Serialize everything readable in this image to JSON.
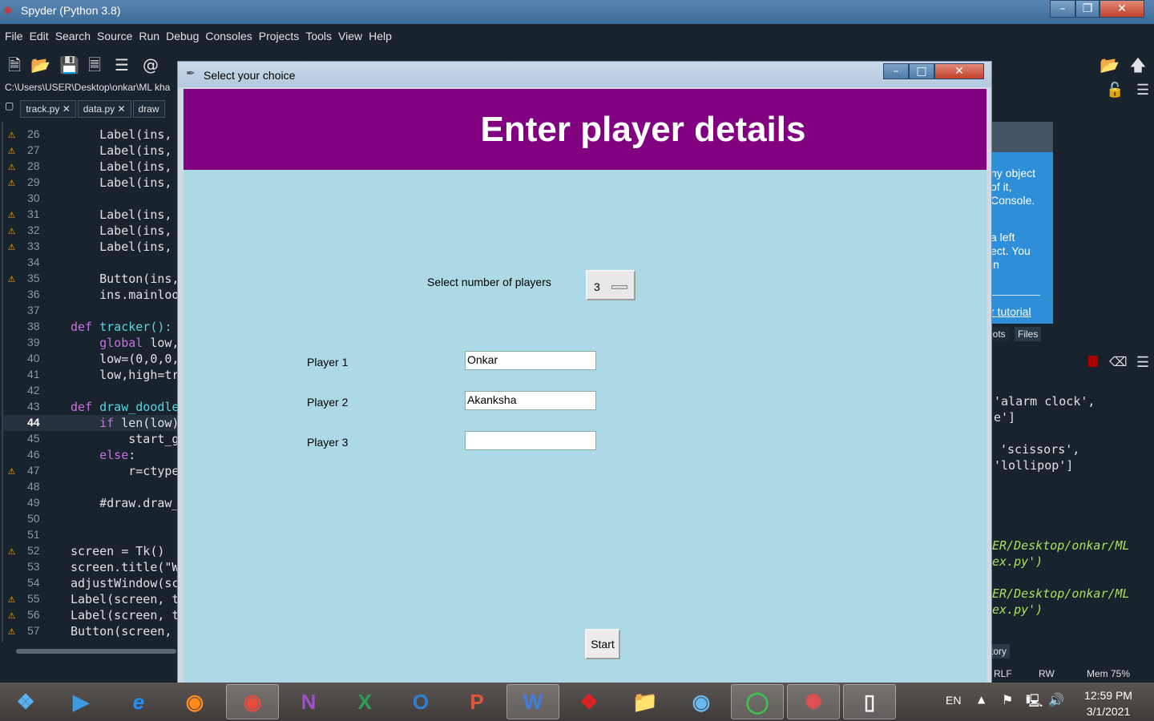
{
  "app": {
    "title": "Spyder (Python 3.8)",
    "menu": [
      "File",
      "Edit",
      "Search",
      "Source",
      "Run",
      "Debug",
      "Consoles",
      "Projects",
      "Tools",
      "View",
      "Help"
    ],
    "path": "C:\\Users\\USER\\Desktop\\onkar\\ML kha",
    "tabs": [
      "track.py",
      "data.py",
      "draw"
    ]
  },
  "editor": {
    "lines": [
      {
        "n": "26",
        "warn": true,
        "code": "    Label(ins,"
      },
      {
        "n": "27",
        "warn": true,
        "code": "    Label(ins,"
      },
      {
        "n": "28",
        "warn": true,
        "code": "    Label(ins,"
      },
      {
        "n": "29",
        "warn": true,
        "code": "    Label(ins,"
      },
      {
        "n": "30",
        "warn": false,
        "code": ""
      },
      {
        "n": "31",
        "warn": true,
        "code": "    Label(ins,"
      },
      {
        "n": "32",
        "warn": true,
        "code": "    Label(ins,"
      },
      {
        "n": "33",
        "warn": true,
        "code": "    Label(ins,"
      },
      {
        "n": "34",
        "warn": false,
        "code": ""
      },
      {
        "n": "35",
        "warn": true,
        "code": "    Button(ins,"
      },
      {
        "n": "36",
        "warn": false,
        "code": "    ins.mainloo"
      },
      {
        "n": "37",
        "warn": false,
        "code": ""
      },
      {
        "n": "38",
        "warn": false,
        "code": "def tracker():"
      },
      {
        "n": "39",
        "warn": false,
        "code": "    global low,"
      },
      {
        "n": "40",
        "warn": false,
        "code": "    low=(0,0,0,"
      },
      {
        "n": "41",
        "warn": false,
        "code": "    low,high=tr"
      },
      {
        "n": "42",
        "warn": false,
        "code": ""
      },
      {
        "n": "43",
        "warn": false,
        "code": "def draw_doodle"
      },
      {
        "n": "44",
        "warn": false,
        "code": "    if len(low)",
        "cur": true
      },
      {
        "n": "45",
        "warn": false,
        "code": "        start_g"
      },
      {
        "n": "46",
        "warn": false,
        "code": "    else:"
      },
      {
        "n": "47",
        "warn": true,
        "code": "        r=ctype"
      },
      {
        "n": "48",
        "warn": false,
        "code": ""
      },
      {
        "n": "49",
        "warn": false,
        "code": "    #draw.draw_"
      },
      {
        "n": "50",
        "warn": false,
        "code": ""
      },
      {
        "n": "51",
        "warn": false,
        "code": ""
      },
      {
        "n": "52",
        "warn": true,
        "code": "screen = Tk()"
      },
      {
        "n": "53",
        "warn": false,
        "code": "screen.title(\"W"
      },
      {
        "n": "54",
        "warn": false,
        "code": "adjustWindow(sc"
      },
      {
        "n": "55",
        "warn": true,
        "code": "Label(screen, t"
      },
      {
        "n": "56",
        "warn": true,
        "code": "Label(screen, t"
      },
      {
        "n": "57",
        "warn": true,
        "code": "Button(screen, "
      }
    ]
  },
  "help": {
    "lines": [
      "ny object",
      "of it,",
      "Console.",
      "",
      "a left",
      "ect. You",
      "in"
    ],
    "link": "r tutorial",
    "tabs": [
      "lots",
      "Files"
    ]
  },
  "console": {
    "lines": [
      "'alarm clock',",
      "e']",
      "",
      "'scissors',",
      "'lollipop']"
    ],
    "paths": [
      "ER/Desktop/onkar/ML",
      "ex.py')",
      "",
      "ER/Desktop/onkar/ML",
      "ex.py')"
    ],
    "history_tab": "tory"
  },
  "status": {
    "eol": "RLF",
    "rw": "RW",
    "mem": "Mem 75%"
  },
  "dialog": {
    "title": "Select your choice",
    "header": "Enter player details",
    "num_label": "Select number of players",
    "num_value": "3",
    "players": [
      {
        "label": "Player 1",
        "value": "Onkar"
      },
      {
        "label": "Player 2",
        "value": "Akanksha"
      },
      {
        "label": "Player 3",
        "value": ""
      }
    ],
    "start_label": "Start"
  },
  "taskbar": {
    "lang": "EN",
    "time": "12:59 PM",
    "date": "3/1/2021"
  }
}
